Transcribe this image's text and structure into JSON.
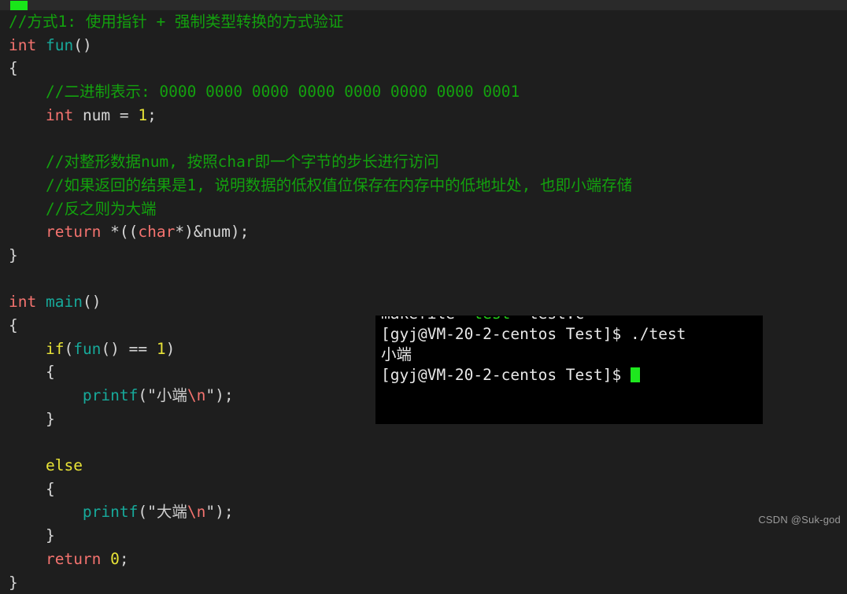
{
  "window": {
    "background_color": "#1e1e1e",
    "cursor_line_color": "#2a2a2a",
    "caret_color": "#19e619"
  },
  "theme": {
    "comment": "#13a10e",
    "keyword": "#f4736f",
    "function": "#17a99a",
    "control": "#e8e337",
    "punctuation": "#d6d6d6",
    "string": "#d0d0d0",
    "escape": "#f4736f"
  },
  "editor": {
    "code_lines": [
      {
        "indent": 0,
        "tokens": [
          {
            "t": "//方式1: 使用指针 + 强制类型转换的方式验证",
            "c": "cm"
          }
        ]
      },
      {
        "indent": 0,
        "tokens": [
          {
            "t": "int",
            "c": "kw"
          },
          {
            "t": " ",
            "c": "pl"
          },
          {
            "t": "fun",
            "c": "fn"
          },
          {
            "t": "()",
            "c": "pun"
          }
        ]
      },
      {
        "indent": 0,
        "tokens": [
          {
            "t": "{",
            "c": "pun"
          }
        ]
      },
      {
        "indent": 1,
        "tokens": [
          {
            "t": "//二进制表示: 0000 0000 0000 0000 0000 0000 0000 0001",
            "c": "cm"
          }
        ]
      },
      {
        "indent": 1,
        "tokens": [
          {
            "t": "int",
            "c": "kw"
          },
          {
            "t": " num ",
            "c": "pl"
          },
          {
            "t": "=",
            "c": "pun"
          },
          {
            "t": " ",
            "c": "pl"
          },
          {
            "t": "1",
            "c": "num"
          },
          {
            "t": ";",
            "c": "pun"
          }
        ]
      },
      {
        "indent": 0,
        "tokens": []
      },
      {
        "indent": 1,
        "tokens": [
          {
            "t": "//对整形数据num, 按照char即一个字节的步长进行访问",
            "c": "cm"
          }
        ]
      },
      {
        "indent": 1,
        "tokens": [
          {
            "t": "//如果返回的结果是1, 说明数据的低权值位保存在内存中的低地址处, 也即小端存储",
            "c": "cm"
          }
        ]
      },
      {
        "indent": 1,
        "tokens": [
          {
            "t": "//反之则为大端",
            "c": "cm"
          }
        ]
      },
      {
        "indent": 1,
        "tokens": [
          {
            "t": "return",
            "c": "kw"
          },
          {
            "t": " *((",
            "c": "pun"
          },
          {
            "t": "char",
            "c": "kw"
          },
          {
            "t": "*)&",
            "c": "pun"
          },
          {
            "t": "num",
            "c": "pl"
          },
          {
            "t": ");",
            "c": "pun"
          }
        ]
      },
      {
        "indent": 0,
        "tokens": [
          {
            "t": "}",
            "c": "pun"
          }
        ]
      },
      {
        "indent": 0,
        "tokens": []
      },
      {
        "indent": 0,
        "tokens": [
          {
            "t": "int",
            "c": "kw"
          },
          {
            "t": " ",
            "c": "pl"
          },
          {
            "t": "main",
            "c": "fn"
          },
          {
            "t": "()",
            "c": "pun"
          }
        ]
      },
      {
        "indent": 0,
        "tokens": [
          {
            "t": "{",
            "c": "pun"
          }
        ]
      },
      {
        "indent": 1,
        "tokens": [
          {
            "t": "if",
            "c": "ctl"
          },
          {
            "t": "(",
            "c": "pun"
          },
          {
            "t": "fun",
            "c": "fn"
          },
          {
            "t": "() == ",
            "c": "pun"
          },
          {
            "t": "1",
            "c": "num"
          },
          {
            "t": ")",
            "c": "pun"
          }
        ]
      },
      {
        "indent": 1,
        "tokens": [
          {
            "t": "{",
            "c": "pun"
          }
        ]
      },
      {
        "indent": 2,
        "tokens": [
          {
            "t": "printf",
            "c": "fn"
          },
          {
            "t": "(\"",
            "c": "pun"
          },
          {
            "t": "小端",
            "c": "str"
          },
          {
            "t": "\\n",
            "c": "esc"
          },
          {
            "t": "\");",
            "c": "pun"
          }
        ]
      },
      {
        "indent": 1,
        "tokens": [
          {
            "t": "}",
            "c": "pun"
          }
        ]
      },
      {
        "indent": 0,
        "tokens": []
      },
      {
        "indent": 1,
        "tokens": [
          {
            "t": "else",
            "c": "ctl"
          }
        ]
      },
      {
        "indent": 1,
        "tokens": [
          {
            "t": "{",
            "c": "pun"
          }
        ]
      },
      {
        "indent": 2,
        "tokens": [
          {
            "t": "printf",
            "c": "fn"
          },
          {
            "t": "(\"",
            "c": "pun"
          },
          {
            "t": "大端",
            "c": "str"
          },
          {
            "t": "\\n",
            "c": "esc"
          },
          {
            "t": "\");",
            "c": "pun"
          }
        ]
      },
      {
        "indent": 1,
        "tokens": [
          {
            "t": "}",
            "c": "pun"
          }
        ]
      },
      {
        "indent": 1,
        "tokens": [
          {
            "t": "return",
            "c": "kw"
          },
          {
            "t": " ",
            "c": "pl"
          },
          {
            "t": "0",
            "c": "num"
          },
          {
            "t": ";",
            "c": "pun"
          }
        ]
      },
      {
        "indent": 0,
        "tokens": [
          {
            "t": "}",
            "c": "pun"
          }
        ]
      }
    ]
  },
  "terminal": {
    "lines": [
      {
        "segments": [
          {
            "t": "makefile  ",
            "c": "t-white"
          },
          {
            "t": "test",
            "c": "t-green"
          },
          {
            "t": "  test.c",
            "c": "t-white"
          }
        ]
      },
      {
        "segments": [
          {
            "t": "[gyj@VM-20-2-centos Test]$ ./test",
            "c": "t-white"
          }
        ]
      },
      {
        "segments": [
          {
            "t": "小端",
            "c": "t-white"
          }
        ]
      },
      {
        "segments": [
          {
            "t": "[gyj@VM-20-2-centos Test]$ ",
            "c": "t-white"
          }
        ],
        "cursor": true
      },
      {
        "segments": []
      },
      {
        "segments": []
      }
    ],
    "prompt": "[gyj@VM-20-2-centos Test]$",
    "command": "./test",
    "output": "小端",
    "cursor_color": "#1ee81e"
  },
  "watermark": {
    "text": "CSDN @Suk-god"
  }
}
